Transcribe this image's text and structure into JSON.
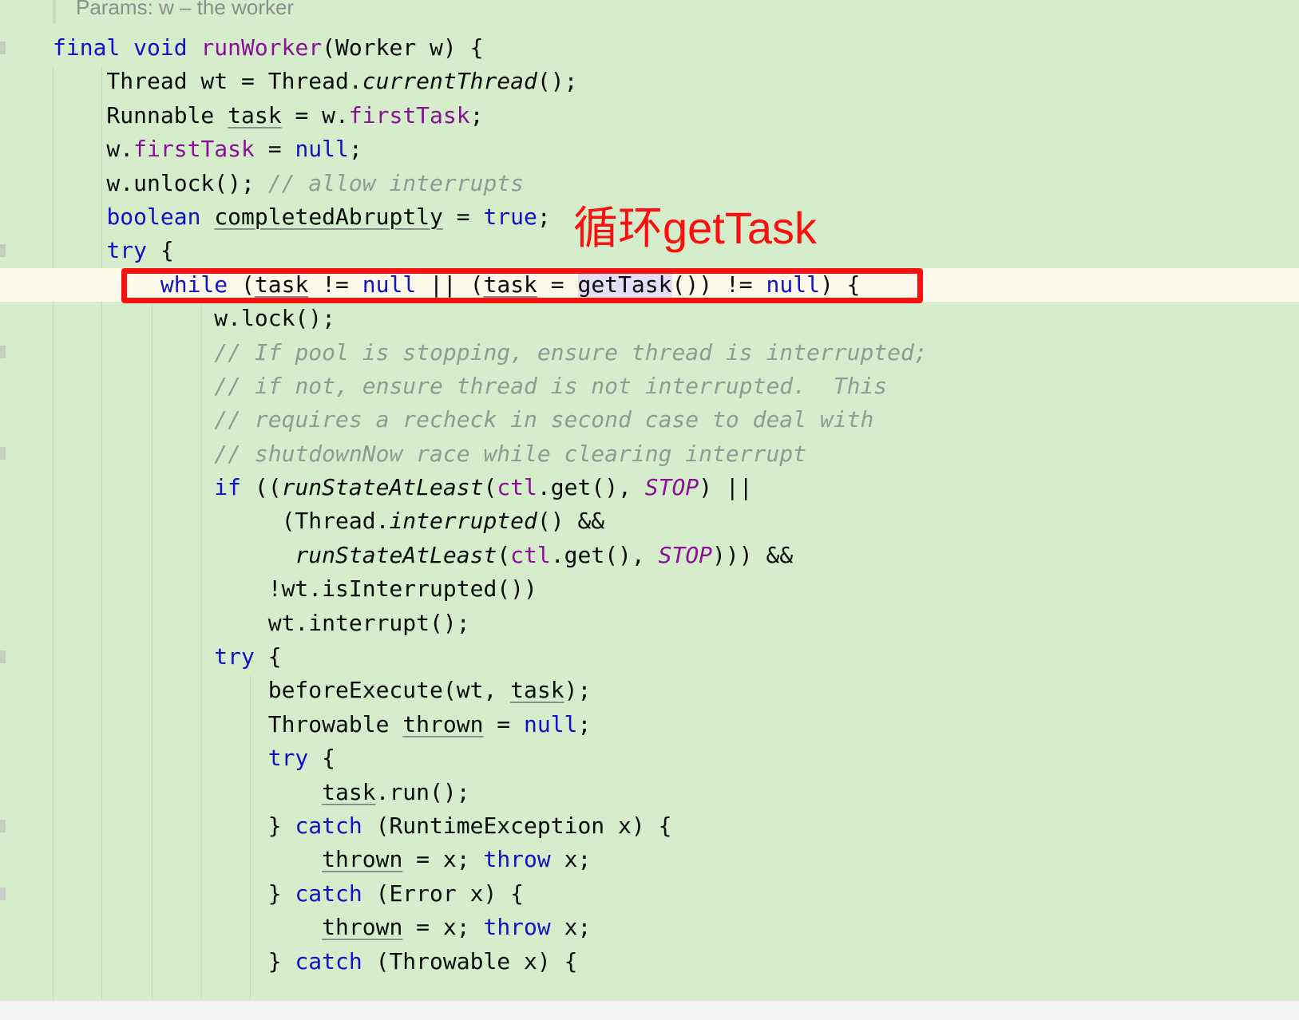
{
  "editor": {
    "background_color": "#d6edcb",
    "current_line_color": "#fdfaec",
    "language": "Java",
    "font_size_px": 28,
    "line_height_px": 42.4
  },
  "javadoc": {
    "text": "Params: w – the worker"
  },
  "annotation": {
    "text": "循环getTask",
    "color": "#fb0f0f",
    "box_color": "#fb0f0f",
    "box_target_line_index": 7
  },
  "caret": {
    "line_index": 7,
    "before_token": "getTask",
    "selected_identifier": "getTask"
  },
  "colors": {
    "keyword": "#0f12c8",
    "field": "#8a1098",
    "comment": "#919a93",
    "text": "#0b0b0b",
    "identifier_highlight": "#e3ddf6",
    "indent_guide": "#c2dfb6",
    "bottom_strip": "#f3f3f3"
  },
  "indent_guides_x": [
    66,
    127,
    190,
    252,
    313
  ],
  "code_lines": [
    {
      "index": 0,
      "current": false,
      "plain": "final void runWorker(Worker w) {"
    },
    {
      "index": 1,
      "current": false,
      "plain": "    Thread wt = Thread.currentThread();"
    },
    {
      "index": 2,
      "current": false,
      "plain": "    Runnable task = w.firstTask;"
    },
    {
      "index": 3,
      "current": false,
      "plain": "    w.firstTask = null;"
    },
    {
      "index": 4,
      "current": false,
      "plain": "    w.unlock(); // allow interrupts"
    },
    {
      "index": 5,
      "current": false,
      "plain": "    boolean completedAbruptly = true;"
    },
    {
      "index": 6,
      "current": false,
      "plain": "    try {"
    },
    {
      "index": 7,
      "current": true,
      "plain": "        while (task != null || (task = getTask()) != null) {"
    },
    {
      "index": 8,
      "current": false,
      "plain": "            w.lock();"
    },
    {
      "index": 9,
      "current": false,
      "plain": "            // If pool is stopping, ensure thread is interrupted;"
    },
    {
      "index": 10,
      "current": false,
      "plain": "            // if not, ensure thread is not interrupted.  This"
    },
    {
      "index": 11,
      "current": false,
      "plain": "            // requires a recheck in second case to deal with"
    },
    {
      "index": 12,
      "current": false,
      "plain": "            // shutdownNow race while clearing interrupt"
    },
    {
      "index": 13,
      "current": false,
      "plain": "            if ((runStateAtLeast(ctl.get(), STOP) ||"
    },
    {
      "index": 14,
      "current": false,
      "plain": "                 (Thread.interrupted() &&"
    },
    {
      "index": 15,
      "current": false,
      "plain": "                  runStateAtLeast(ctl.get(), STOP))) &&"
    },
    {
      "index": 16,
      "current": false,
      "plain": "                !wt.isInterrupted())"
    },
    {
      "index": 17,
      "current": false,
      "plain": "                wt.interrupt();"
    },
    {
      "index": 18,
      "current": false,
      "plain": "            try {"
    },
    {
      "index": 19,
      "current": false,
      "plain": "                beforeExecute(wt, task);"
    },
    {
      "index": 20,
      "current": false,
      "plain": "                Throwable thrown = null;"
    },
    {
      "index": 21,
      "current": false,
      "plain": "                try {"
    },
    {
      "index": 22,
      "current": false,
      "plain": "                    task.run();"
    },
    {
      "index": 23,
      "current": false,
      "plain": "                } catch (RuntimeException x) {"
    },
    {
      "index": 24,
      "current": false,
      "plain": "                    thrown = x; throw x;"
    },
    {
      "index": 25,
      "current": false,
      "plain": "                } catch (Error x) {"
    },
    {
      "index": 26,
      "current": false,
      "plain": "                    thrown = x; throw x;"
    },
    {
      "index": 27,
      "current": false,
      "plain": "                } catch (Throwable x) {"
    }
  ]
}
